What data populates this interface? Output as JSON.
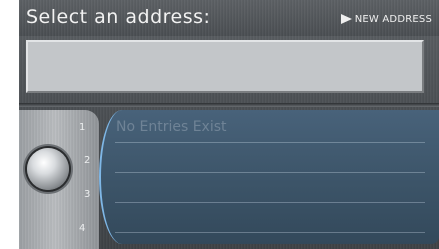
{
  "header": {
    "title": "Select an address:",
    "new_address_label": "NEW ADDRESS"
  },
  "address_box": {
    "value": ""
  },
  "list": {
    "rows": [
      {
        "number": "1",
        "text": "No Entries Exist"
      },
      {
        "number": "2",
        "text": ""
      },
      {
        "number": "3",
        "text": ""
      },
      {
        "number": "4",
        "text": ""
      }
    ]
  },
  "icons": {
    "new_address_arrow": "play-triangle-icon",
    "knob": "selector-knob-icon"
  },
  "colors": {
    "background": "#4c5054",
    "list_panel": "#3c5468",
    "list_accent": "#7fb7e6",
    "address_box": "#c3c6c9"
  }
}
